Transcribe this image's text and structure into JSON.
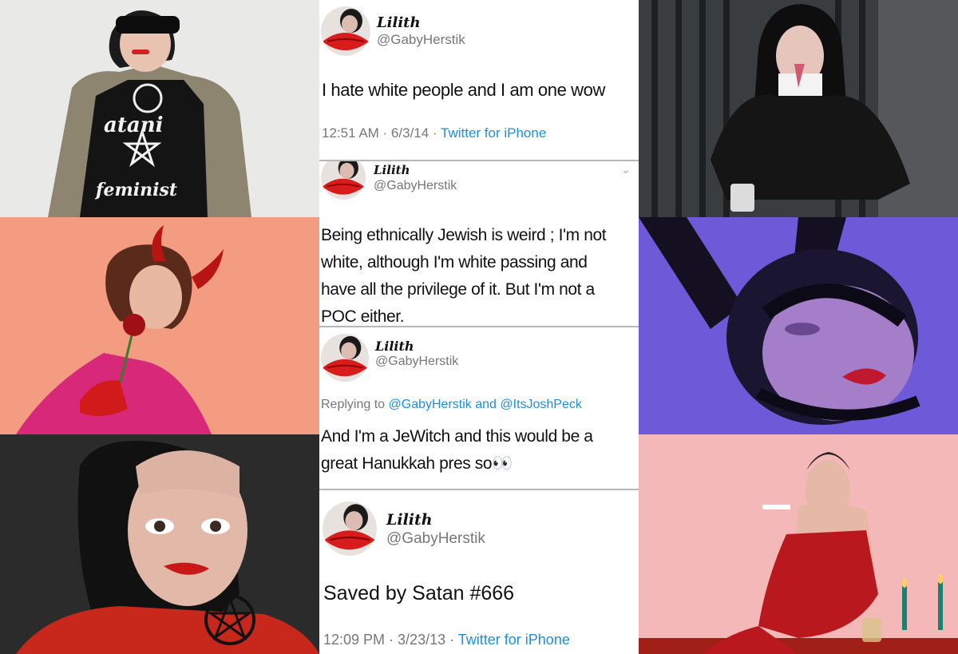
{
  "photos": {
    "top_left": {
      "shirt_line1": "atani",
      "shirt_line2": "feminist"
    }
  },
  "tweets": [
    {
      "name": "Lilith",
      "handle": "@GabyHerstik",
      "text": "I hate white people and I am one wow",
      "time": "12:51 AM · 6/3/14 ·",
      "source": "Twitter for iPhone"
    },
    {
      "name": "Lilith",
      "handle": "@GabyHerstik",
      "text_lines": [
        "Being ethnically Jewish is weird ; I'm not",
        "white, although I'm white passing and",
        "have all the privilege of it. But I'm not a",
        "POC either."
      ]
    },
    {
      "name": "Lilith",
      "handle": "@GabyHerstik",
      "reply_prefix": "Replying to",
      "reply_user1": "@GabyHerstik",
      "reply_and": "and",
      "reply_user2": "@ItsJoshPeck",
      "text_line1": "And I'm a JeWitch and this would be a",
      "text_line2": "great Hanukkah pres so👀"
    },
    {
      "name": "Lilith",
      "handle": "@GabyHerstik",
      "text": "Saved by Satan #666",
      "time": "12:09 PM · 3/23/13 ·",
      "source": "Twitter for iPhone"
    }
  ],
  "icons": {
    "chevron": "chevron-down-icon",
    "avatar": "avatar-red-lips-icon"
  },
  "colors": {
    "link_blue": "#1d8fe0",
    "meta_gray": "#777777",
    "lip_red": "#d81c1c"
  }
}
